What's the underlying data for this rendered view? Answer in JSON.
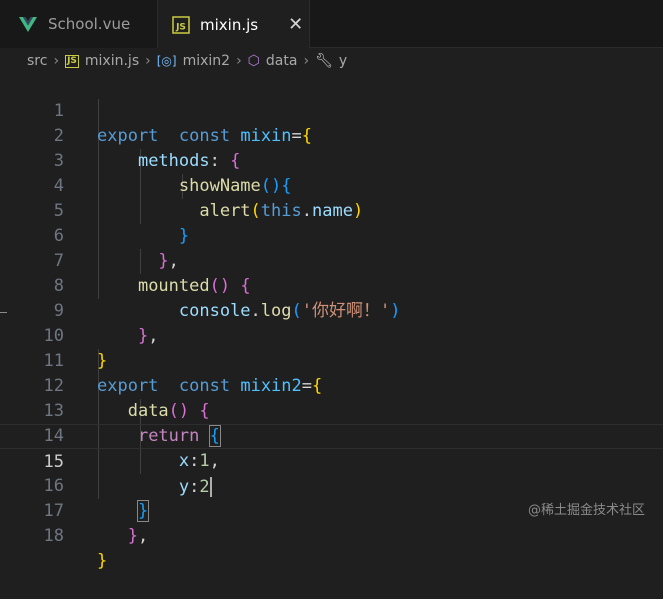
{
  "tabs": [
    {
      "label": "School.vue",
      "icon": "vue-logo-icon"
    },
    {
      "label": "mixin.js",
      "icon": "js-file-icon",
      "close": "✕"
    }
  ],
  "breadcrumb": {
    "items": [
      "src",
      "mixin.js",
      "mixin2",
      "data",
      "y"
    ],
    "icons": [
      "js-file-icon",
      "variable-icon",
      "method-cube-icon",
      "property-wrench-icon"
    ]
  },
  "editor": {
    "current_line": 15,
    "line_numbers": [
      "1",
      "2",
      "3",
      "4",
      "5",
      "6",
      "7",
      "8",
      "9",
      "10",
      "11",
      "12",
      "13",
      "14",
      "15",
      "16",
      "17",
      "18"
    ],
    "tokens": {
      "export": "export",
      "const": "const",
      "mixin": "mixin",
      "mixin2": "mixin2",
      "eq": "=",
      "methods": "methods",
      "colon": ":",
      "showName": "showName",
      "alert": "alert",
      "this": "this",
      "dot": ".",
      "name": "name",
      "mounted": "mounted",
      "console": "console",
      "log": "log",
      "greeting": "'你好啊！'",
      "data": "data",
      "return": "return",
      "x": "x",
      "y": "y",
      "one": "1",
      "two": "2",
      "comma": ",",
      "brace_open": "{",
      "brace_close": "}",
      "paren_open": "(",
      "paren_close": ")",
      "parens": "()"
    }
  },
  "colors": {
    "background": "#1f1f1f",
    "keyword": "#569cd6",
    "control_keyword": "#c586c0",
    "const_var": "#4fc1ff",
    "function": "#dcdcaa",
    "property": "#9cdcfe",
    "string": "#ce9178",
    "number": "#b5cea8"
  },
  "watermark": "@稀土掘金技术社区"
}
